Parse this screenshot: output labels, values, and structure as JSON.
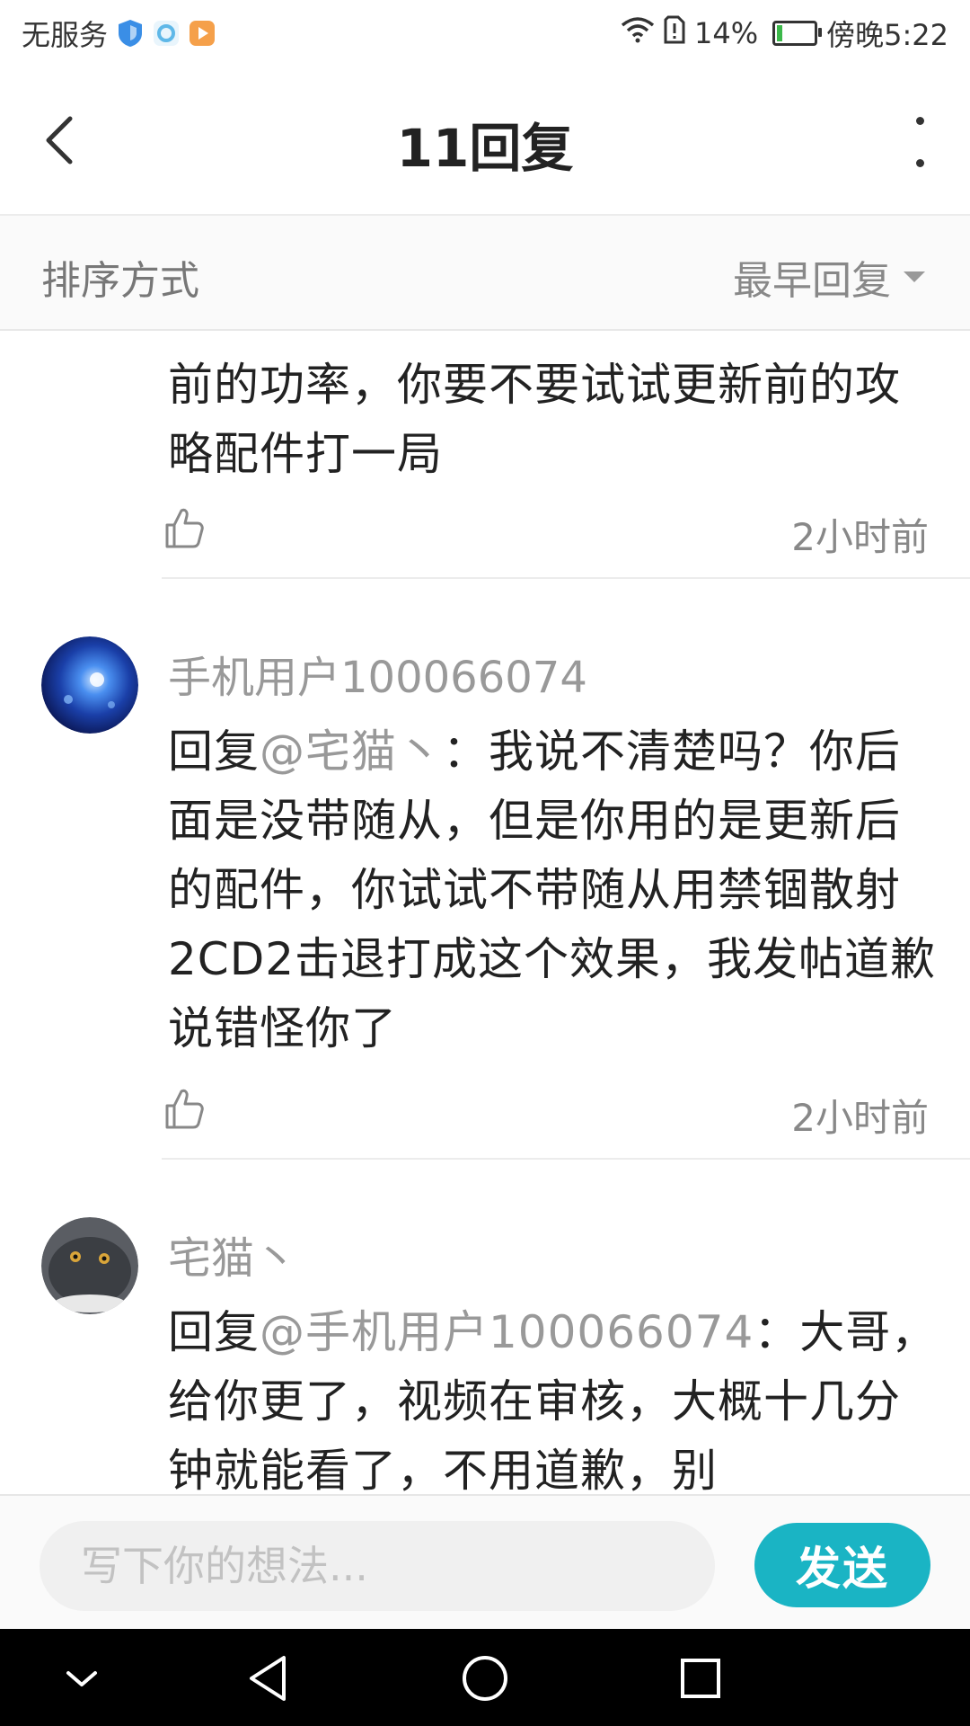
{
  "status_bar": {
    "carrier": "无服务",
    "battery_percent": "14%",
    "battery_level": 0.14,
    "time": "傍晚5:22",
    "colors": {
      "shield": "#3a8ee6",
      "app2": "#5fb8e8",
      "app3": "#f5a04a",
      "battery_fill": "#3cb84a"
    }
  },
  "header": {
    "title": "11回复"
  },
  "sort": {
    "label": "排序方式",
    "value": "最早回复"
  },
  "comments": [
    {
      "body": "前的功率，你要不要试试更新前的攻略配件打一局",
      "time": "2小时前"
    },
    {
      "username": "手机用户100066074",
      "reply_prefix": "回复",
      "reply_to": "@宅猫丶",
      "body": "：我说不清楚吗？你后面是没带随从，但是你用的是更新后的配件，你试试不带随从用禁锢散射2CD2击退打成这个效果，我发帖道歉说错怪你了",
      "time": "2小时前"
    },
    {
      "username": "宅猫丶",
      "reply_prefix": "回复",
      "reply_to": "@手机用户100066074",
      "body": "：大哥，给你更了，视频在审核，大概十几分钟就能看了，不用道歉，别"
    }
  ],
  "input_bar": {
    "placeholder": "写下你的想法...",
    "send_label": "发送",
    "accent": "#1ab4c4"
  },
  "nav_icons": [
    "chevron-down-icon",
    "back-triangle-icon",
    "home-circle-icon",
    "recents-square-icon"
  ]
}
